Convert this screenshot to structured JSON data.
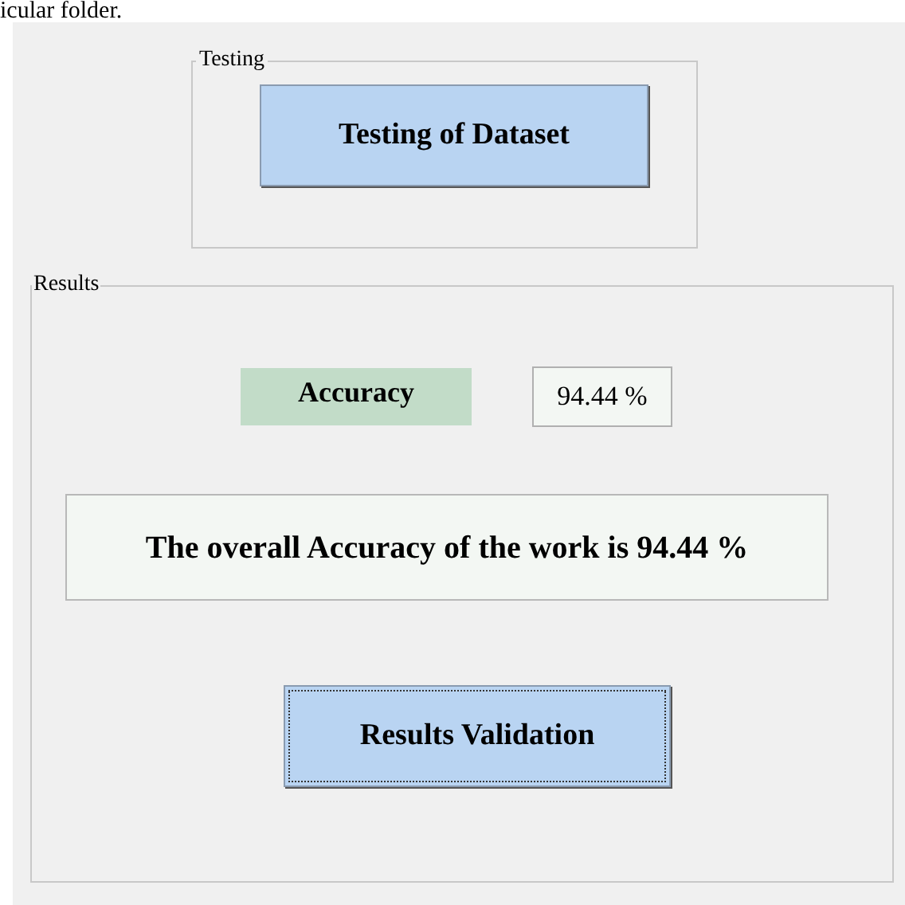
{
  "document_text": "icular folder.",
  "testing": {
    "title": "Testing",
    "button": {
      "label": "Testing of Dataset",
      "focused": false
    }
  },
  "results": {
    "title": "Results",
    "accuracy_label": "Accuracy",
    "accuracy_value": "94.44 %",
    "message": "The overall Accuracy of the work is 94.44 %",
    "button": {
      "label": "Results Validation",
      "focused": true
    }
  }
}
